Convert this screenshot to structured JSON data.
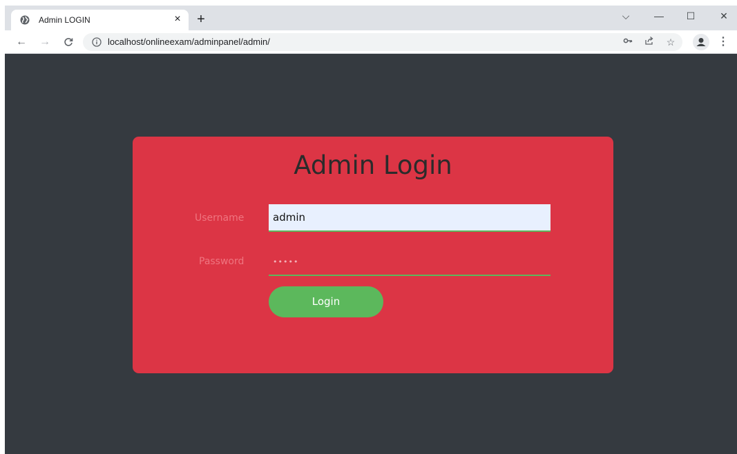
{
  "browser": {
    "tab": {
      "title": "Admin LOGIN",
      "close": "×"
    },
    "new_tab": "+",
    "window_controls": {
      "dropdown": "⌵",
      "minimize": "—",
      "maximize": "☐",
      "close": "✕"
    },
    "nav": {
      "back": "←",
      "forward": "→",
      "reload": "C"
    },
    "url": {
      "host": "localhost",
      "path": "/onlineexam/adminpanel/admin/"
    },
    "omnibox_icons": [
      "key-icon",
      "share-icon",
      "star-icon"
    ],
    "menu": "⋮"
  },
  "page": {
    "title": "Admin Login",
    "username_label": "Username",
    "username_value": "admin",
    "password_label": "Password",
    "password_value": "•••••",
    "login_label": "Login"
  },
  "colors": {
    "page_bg": "#353a40",
    "card_bg": "#dc3545",
    "button_bg": "#5cb85c",
    "input_autofill": "#e8f0fe"
  }
}
